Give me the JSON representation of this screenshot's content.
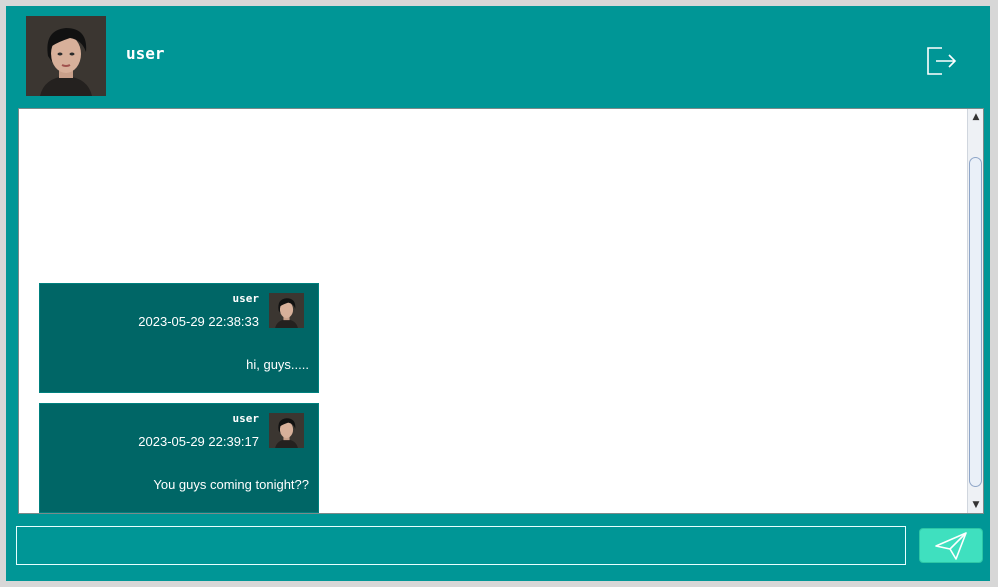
{
  "header": {
    "username": "user",
    "avatar_icon": "user-avatar-portrait",
    "logout_icon": "logout-icon"
  },
  "messages": [
    {
      "sender": "user",
      "timestamp": "2023-05-29 22:38:33",
      "text": "hi, guys....."
    },
    {
      "sender": "user",
      "timestamp": "2023-05-29 22:39:17",
      "text": "You guys coming tonight??"
    }
  ],
  "composer": {
    "value": "",
    "placeholder": "",
    "send_icon": "paper-plane-icon"
  },
  "colors": {
    "window_bg": "#009696",
    "message_bg": "#006666",
    "send_button": "#3fe0bf"
  }
}
